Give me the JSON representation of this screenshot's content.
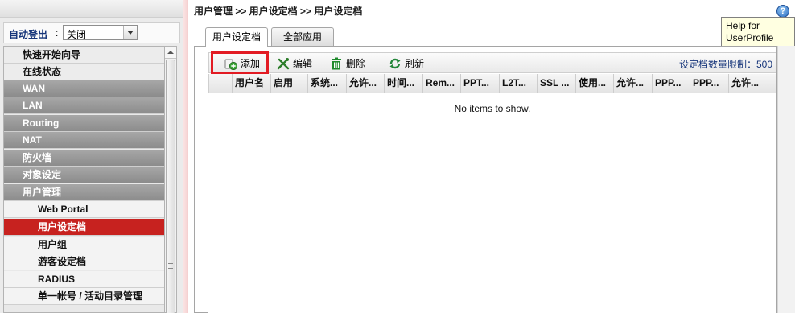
{
  "sidebar": {
    "logout_label": "自动登出",
    "logout_colon": ":",
    "logout_value": "关闭",
    "menu": [
      {
        "label": "快速开始向导",
        "style": "light"
      },
      {
        "label": "在线状态",
        "style": "light"
      },
      {
        "label": "WAN",
        "style": "dark"
      },
      {
        "label": "LAN",
        "style": "dark"
      },
      {
        "label": "Routing",
        "style": "dark"
      },
      {
        "label": "NAT",
        "style": "dark"
      },
      {
        "label": "防火墙",
        "style": "dark"
      },
      {
        "label": "对象设定",
        "style": "dark"
      },
      {
        "label": "用户管理",
        "style": "dark"
      },
      {
        "label": "Web Portal",
        "style": "sub"
      },
      {
        "label": "用户设定档",
        "style": "active"
      },
      {
        "label": "用户组",
        "style": "sub"
      },
      {
        "label": "游客设定档",
        "style": "sub"
      },
      {
        "label": "RADIUS",
        "style": "sub"
      },
      {
        "label": "单一帐号 / 活动目录管理",
        "style": "sub"
      }
    ]
  },
  "header": {
    "breadcrumb": "用户管理 >> 用户设定档 >> 用户设定档",
    "help_icon_glyph": "?",
    "help_tooltip_line1": "Help for",
    "help_tooltip_line2": "UserProfile"
  },
  "tabs": [
    {
      "label": "用户设定档",
      "active": true
    },
    {
      "label": "全部应用",
      "active": false
    }
  ],
  "toolbar": {
    "add_label": "添加",
    "edit_label": "编辑",
    "delete_label": "删除",
    "refresh_label": "刷新",
    "limit_label": "设定档数量限制：",
    "limit_value": "500"
  },
  "table": {
    "columns": [
      "用户名",
      "启用",
      "系统...",
      "允许...",
      "时间...",
      "Rem...",
      "PPT...",
      "L2T...",
      "SSL ...",
      "使用...",
      "允许...",
      "PPP...",
      "PPP...",
      "允许..."
    ],
    "empty_text": "No items to show."
  },
  "colors": {
    "active_menu": "#c7221f",
    "highlight_border": "#e21b23",
    "link_blue": "#16357a"
  }
}
